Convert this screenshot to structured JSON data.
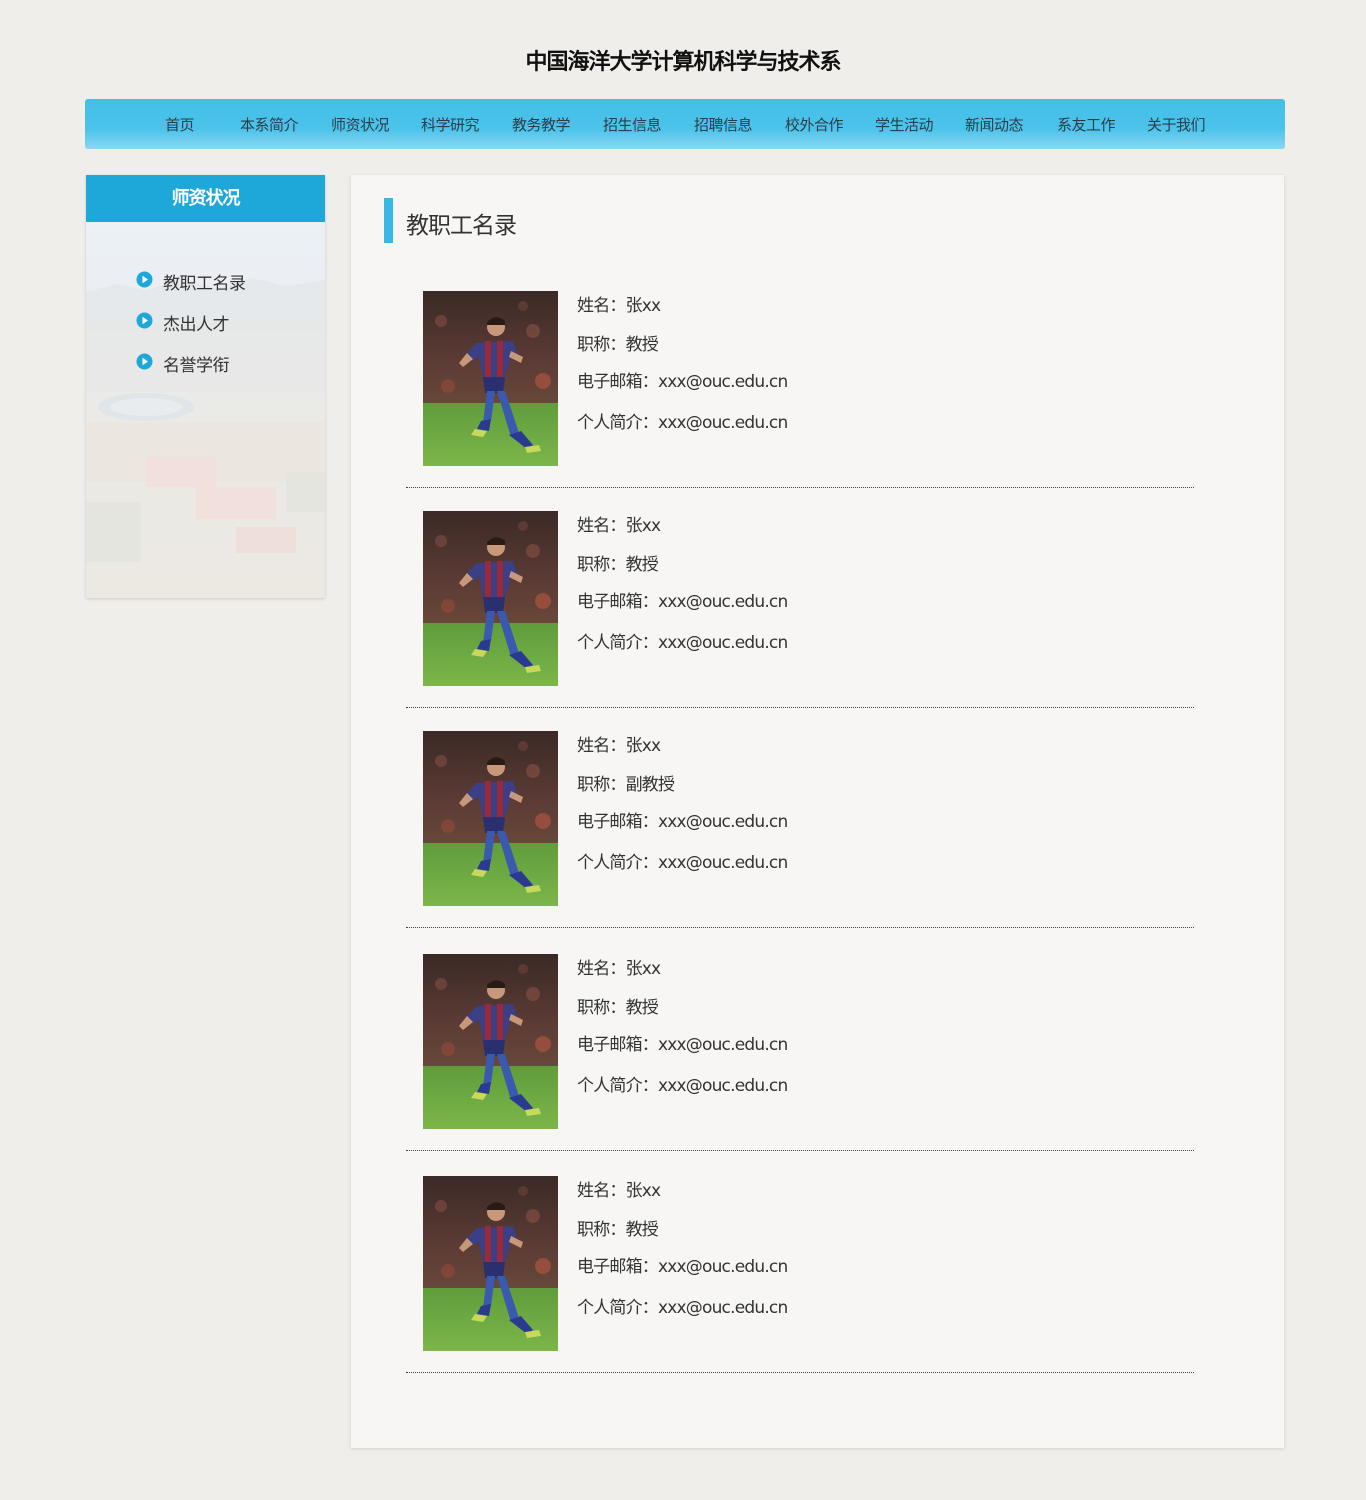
{
  "site": {
    "title": "中国海洋大学计算机科学与技术系"
  },
  "nav": {
    "items": [
      "首页",
      "本系简介",
      "师资状况",
      "科学研究",
      "教务教学",
      "招生信息",
      "招聘信息",
      "校外合作",
      "学生活动",
      "新闻动态",
      "系友工作",
      "关于我们"
    ]
  },
  "sidebar": {
    "title": "师资状况",
    "items": [
      "教职工名录",
      "杰出人才",
      "名誉学衔"
    ],
    "icon": "play-circle-icon",
    "accent_color": "#1ea8d9"
  },
  "main": {
    "title": "教职工名录",
    "accent_color": "#39b7e5"
  },
  "staff": [
    {
      "name": "姓名：张xx",
      "title": "职称：教授",
      "email": "电子邮箱：xxx@ouc.edu.cn",
      "bio": "个人简介：xxx@ouc.edu.cn"
    },
    {
      "name": "姓名：张xx",
      "title": "职称：教授",
      "email": "电子邮箱：xxx@ouc.edu.cn",
      "bio": "个人简介：xxx@ouc.edu.cn"
    },
    {
      "name": "姓名：张xx",
      "title": "职称：副教授",
      "email": "电子邮箱：xxx@ouc.edu.cn",
      "bio": "个人简介：xxx@ouc.edu.cn"
    },
    {
      "name": "姓名：张xx",
      "title": "职称：教授",
      "email": "电子邮箱：xxx@ouc.edu.cn",
      "bio": "个人简介：xxx@ouc.edu.cn"
    },
    {
      "name": "姓名：张xx",
      "title": "职称：教授",
      "email": "电子邮箱：xxx@ouc.edu.cn",
      "bio": "个人简介：xxx@ouc.edu.cn"
    }
  ]
}
